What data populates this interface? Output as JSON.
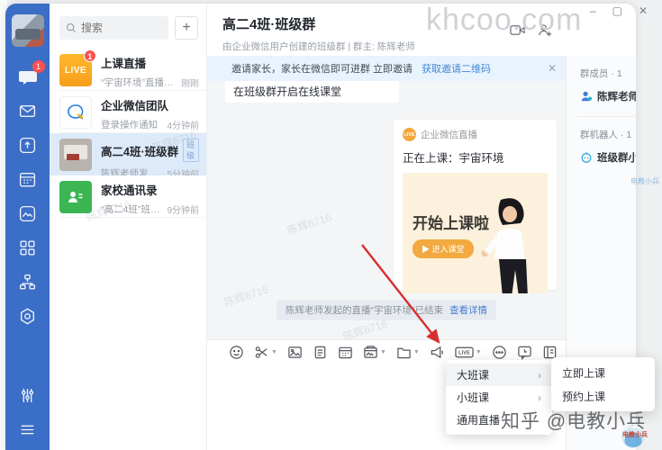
{
  "watermarks": {
    "top": "khcoo.com",
    "diagonal": "陈辉6716",
    "bottom": "知乎 @电教小兵",
    "logo_label": "电教小兵",
    "side_label": "电教小兵"
  },
  "window_controls": {
    "minimize": "–",
    "maximize": "▢",
    "close": "✕"
  },
  "rail": {
    "chat_badge": "1"
  },
  "chat_list": {
    "search_placeholder": "搜索",
    "add_button": "+",
    "items": [
      {
        "icon": "live-icon",
        "icon_label": "LIVE",
        "badge": "1",
        "title": "上课直播",
        "subtitle": "“宇宙环境”直播回放...",
        "time": "刚刚"
      },
      {
        "icon": "wecom-icon",
        "title": "企业微信团队",
        "subtitle": "登录操作通知",
        "time": "4分钟前"
      },
      {
        "icon": "class-photo-icon",
        "title": "高二4班·班级群",
        "tag": "班级",
        "subtitle": "陈辉老师发起的直 ...",
        "time": "5分钟前"
      },
      {
        "icon": "contacts-icon",
        "title": "家校通讯录",
        "subtitle": "“高二4班”班级群已...",
        "time": "9分钟前"
      }
    ]
  },
  "header": {
    "title": "高二4班·班级群",
    "subtitle": "由企业微信用户创建的班级群 | 群主: 陈辉老师"
  },
  "banner": {
    "text": "邀请家长，家长在微信即可进群 立即邀请",
    "link": "获取邀请二维码",
    "close": "✕"
  },
  "messages": {
    "partial_card": "在班级群开启在线课堂",
    "live_card": {
      "badge": "LIVE",
      "source": "企业微信直播",
      "status": "正在上课：宇宙环境",
      "headline": "开始上课啦",
      "button": "▶ 进入课堂"
    },
    "system": {
      "text": "陈辉老师发起的直播“宇宙环境”已结束",
      "link": "查看详情"
    }
  },
  "toolbar": {
    "live_label": "LIVE"
  },
  "side_panel": {
    "members_header": "群成员 · 1",
    "member_name": "陈辉老师·",
    "robots_header": "群机器人 · 1",
    "robot_name": "班级群小助手"
  },
  "live_menu": {
    "items": [
      {
        "label": "大班课",
        "arrow": "›"
      },
      {
        "label": "小班课",
        "arrow": "›"
      },
      {
        "label": "通用直播",
        "arrow": ""
      }
    ],
    "submenu": [
      {
        "label": "立即上课"
      },
      {
        "label": "预约上课"
      }
    ]
  },
  "colors": {
    "rail_blue": "#3b6ec6",
    "accent_blue": "#4289d8",
    "live_orange": "#f3a73e",
    "badge_red": "#fa5151",
    "contacts_green": "#3cb553"
  }
}
